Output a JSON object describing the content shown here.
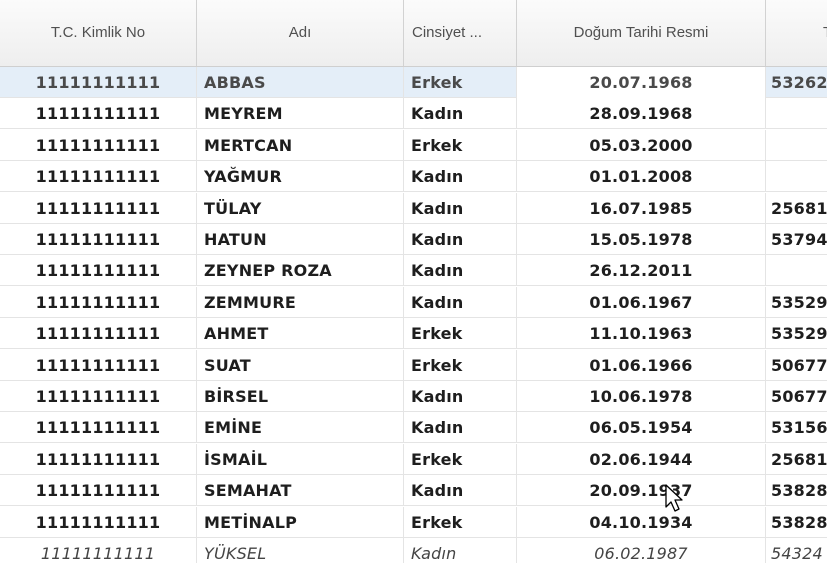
{
  "grid": {
    "columns": [
      {
        "key": "tc",
        "label": "T.C. Kimlik No"
      },
      {
        "key": "name",
        "label": "Adı"
      },
      {
        "key": "sex",
        "label": "Cinsiyet ..."
      },
      {
        "key": "dob",
        "label": "Doğum Tarihi Resmi"
      },
      {
        "key": "phone",
        "label": "T"
      }
    ],
    "rows": [
      {
        "tc": "11111111111",
        "name": "ABBAS",
        "sex": "Erkek",
        "dob": "20.07.1968",
        "phone": "53262",
        "selected": true
      },
      {
        "tc": "11111111111",
        "name": "MEYREM",
        "sex": "Kadın",
        "dob": "28.09.1968",
        "phone": ""
      },
      {
        "tc": "11111111111",
        "name": "MERTCAN",
        "sex": "Erkek",
        "dob": "05.03.2000",
        "phone": ""
      },
      {
        "tc": "11111111111",
        "name": "YAĞMUR",
        "sex": "Kadın",
        "dob": "01.01.2008",
        "phone": ""
      },
      {
        "tc": "11111111111",
        "name": "TÜLAY",
        "sex": "Kadın",
        "dob": "16.07.1985",
        "phone": "25681"
      },
      {
        "tc": "11111111111",
        "name": "HATUN",
        "sex": "Kadın",
        "dob": "15.05.1978",
        "phone": "53794"
      },
      {
        "tc": "11111111111",
        "name": "ZEYNEP ROZA",
        "sex": "Kadın",
        "dob": "26.12.2011",
        "phone": ""
      },
      {
        "tc": "11111111111",
        "name": "ZEMMURE",
        "sex": "Kadın",
        "dob": "01.06.1967",
        "phone": "53529"
      },
      {
        "tc": "11111111111",
        "name": "AHMET",
        "sex": "Erkek",
        "dob": "11.10.1963",
        "phone": "53529"
      },
      {
        "tc": "11111111111",
        "name": "SUAT",
        "sex": "Erkek",
        "dob": "01.06.1966",
        "phone": "50677"
      },
      {
        "tc": "11111111111",
        "name": "BİRSEL",
        "sex": "Kadın",
        "dob": "10.06.1978",
        "phone": "50677"
      },
      {
        "tc": "11111111111",
        "name": "EMİNE",
        "sex": "Kadın",
        "dob": "06.05.1954",
        "phone": "53156"
      },
      {
        "tc": "11111111111",
        "name": "İSMAİL",
        "sex": "Erkek",
        "dob": "02.06.1944",
        "phone": "25681"
      },
      {
        "tc": "11111111111",
        "name": "SEMAHAT",
        "sex": "Kadın",
        "dob": "20.09.1937",
        "phone": "53828"
      },
      {
        "tc": "11111111111",
        "name": "METİNALP",
        "sex": "Erkek",
        "dob": "04.10.1934",
        "phone": "53828"
      },
      {
        "tc": "11111111111",
        "name": "YÜKSEL",
        "sex": "Kadın",
        "dob": "06.02.1987",
        "phone": "54324",
        "italic": true
      }
    ]
  },
  "cursor": {
    "icon": "mouse-pointer-icon"
  }
}
